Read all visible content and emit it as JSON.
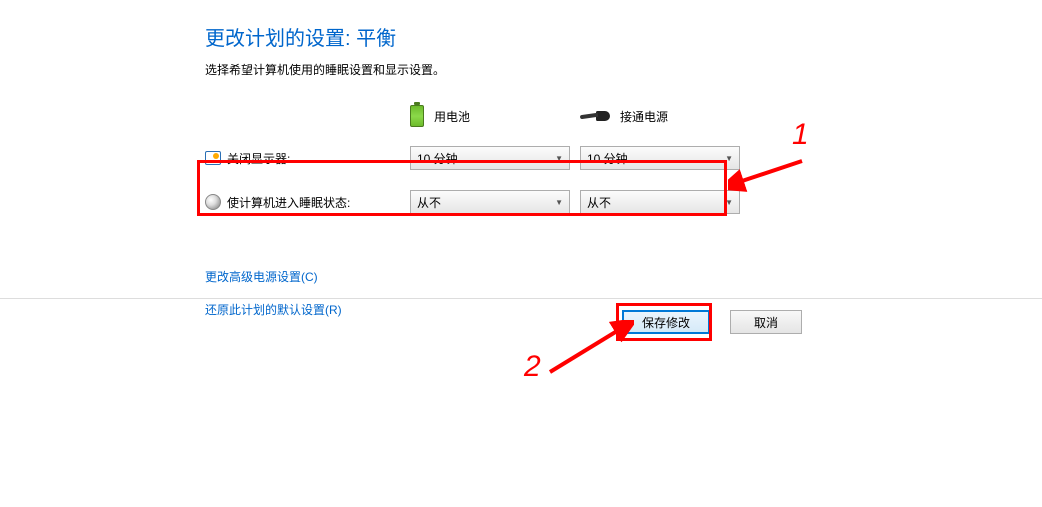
{
  "title": "更改计划的设置: 平衡",
  "subtitle": "选择希望计算机使用的睡眠设置和显示设置。",
  "headers": {
    "battery": "用电池",
    "plugged": "接通电源"
  },
  "rows": {
    "display": {
      "label": "关闭显示器:",
      "battery_value": "10 分钟",
      "plugged_value": "10 分钟"
    },
    "sleep": {
      "label": "使计算机进入睡眠状态:",
      "battery_value": "从不",
      "plugged_value": "从不"
    }
  },
  "links": {
    "advanced": "更改高级电源设置(C)",
    "restore": "还原此计划的默认设置(R)"
  },
  "buttons": {
    "save": "保存修改",
    "cancel": "取消"
  },
  "annotations": {
    "one": "1",
    "two": "2"
  }
}
